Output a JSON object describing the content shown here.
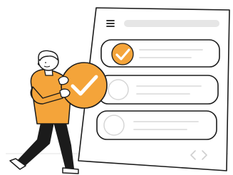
{
  "illustration": {
    "subject": "checklist",
    "items": [
      {
        "checked": true
      },
      {
        "checked": false
      },
      {
        "checked": false
      }
    ],
    "held_badge": {
      "checked": true
    },
    "colors": {
      "accent": "#F4A43A",
      "outline": "#1b1b1b",
      "placeholder": "#e6e6e6",
      "line": "#dedede"
    },
    "icons": [
      "menu-icon",
      "checkmark-icon",
      "chevron-left-icon",
      "chevron-right-icon"
    ]
  }
}
